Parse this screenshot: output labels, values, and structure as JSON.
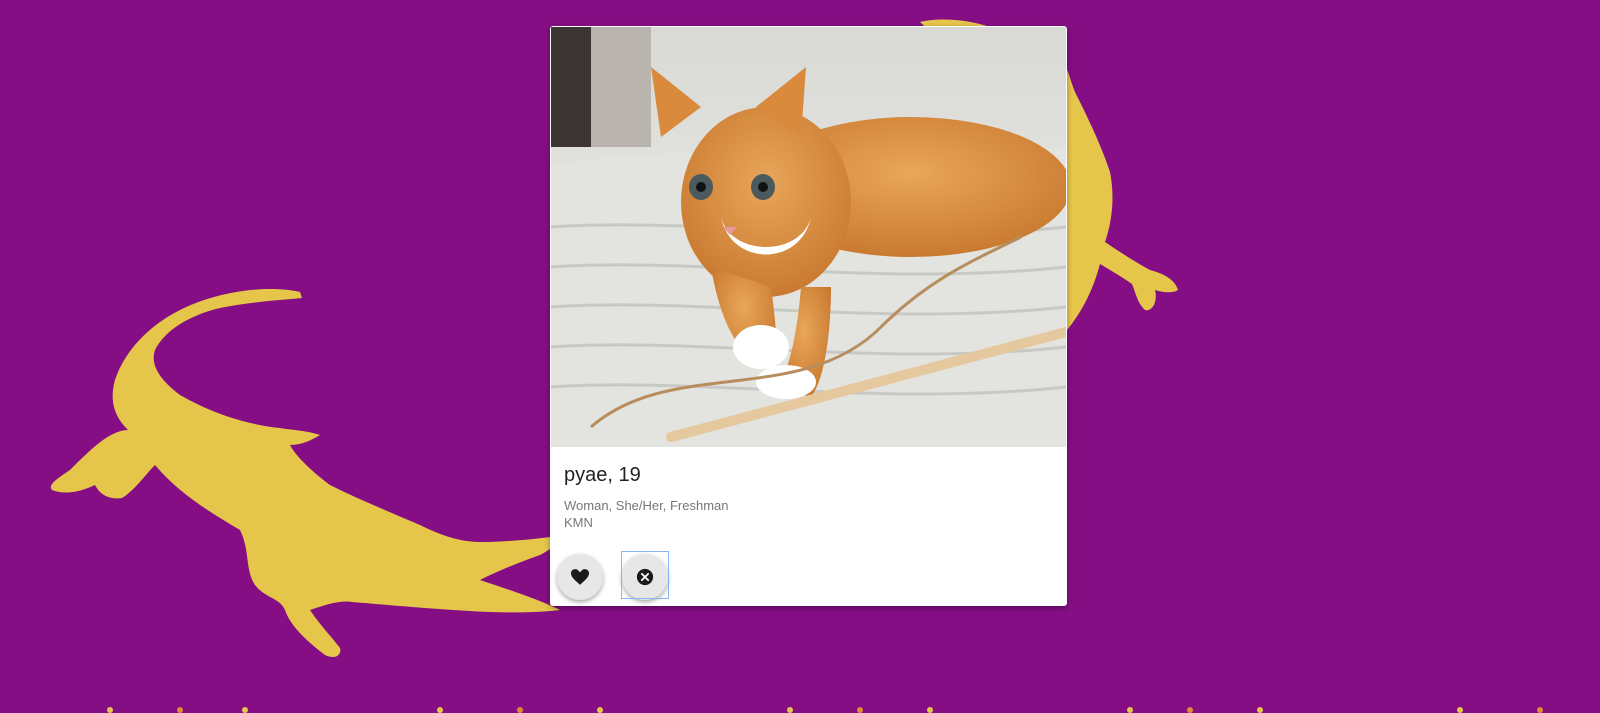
{
  "colors": {
    "background": "#850e84",
    "gator": "#e5c64a",
    "card": "#ffffff",
    "button": "#e7e7e7"
  },
  "profile": {
    "name_age": "pyae, 19",
    "details": "Woman, She/Her, Freshman",
    "group": "KMN"
  },
  "actions": {
    "like_icon": "heart-icon",
    "pass_icon": "close-circle-icon"
  }
}
